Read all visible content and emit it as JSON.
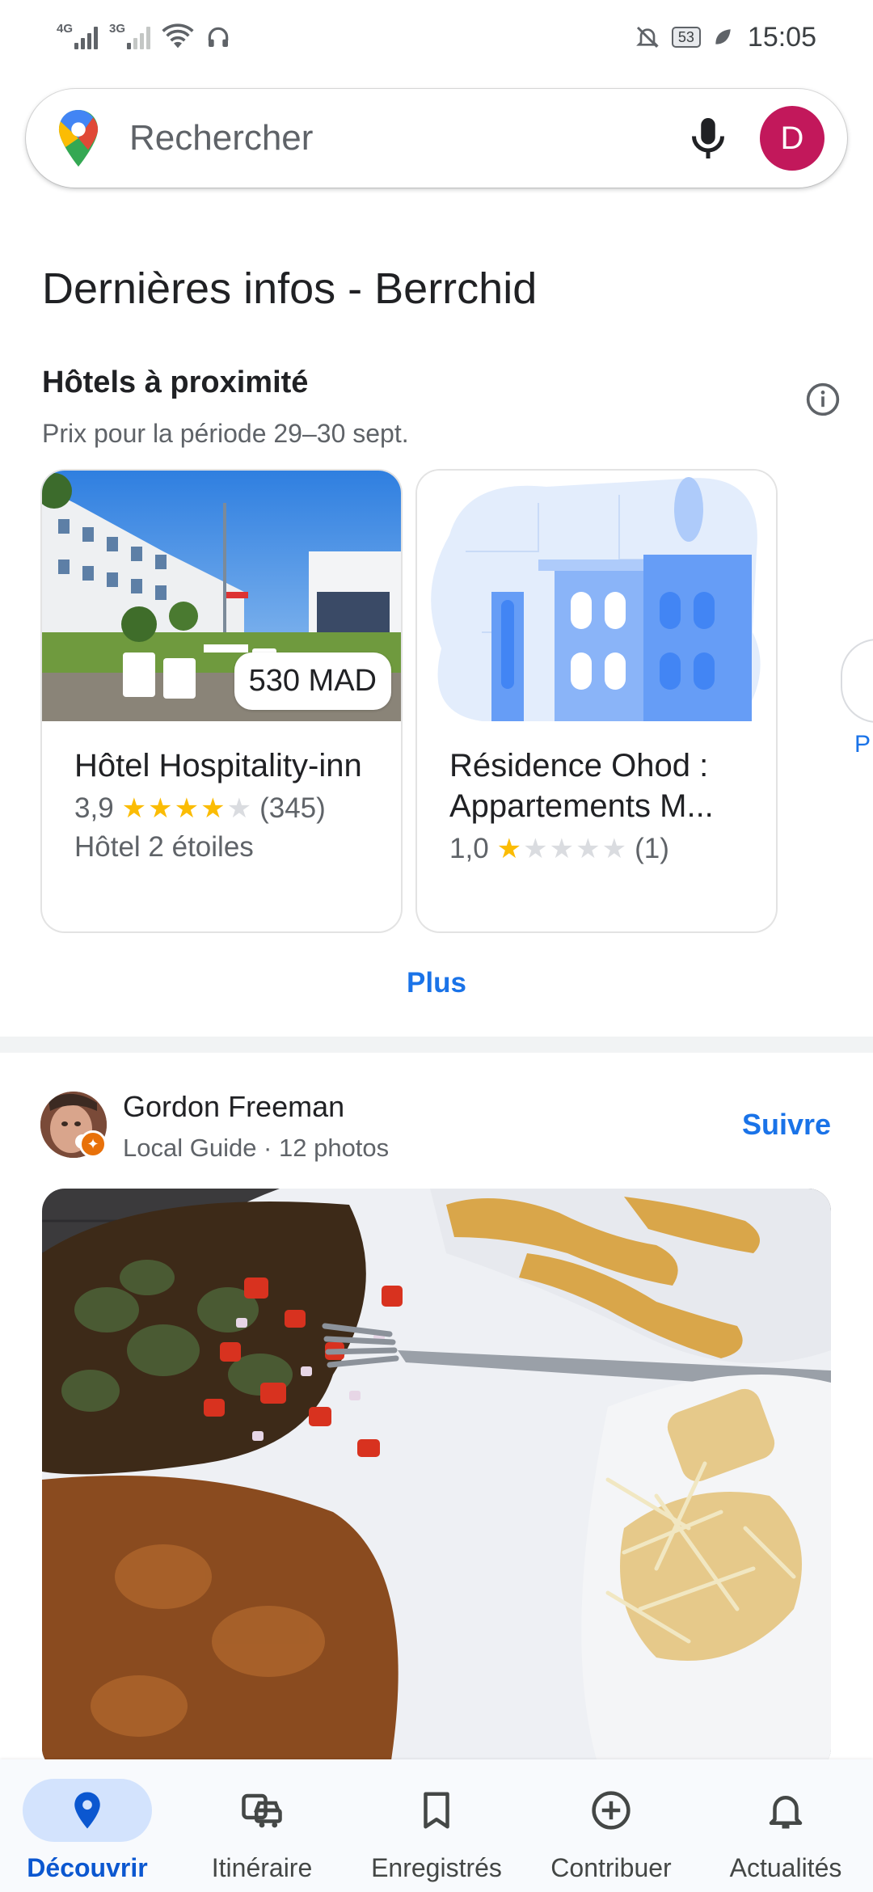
{
  "status_bar": {
    "sim1": "4G",
    "sim2": "3G",
    "battery": "53",
    "time": "15:05"
  },
  "search": {
    "placeholder": "Rechercher",
    "avatar_letter": "D"
  },
  "headline": "Dernières infos - Berrchid",
  "hotels": {
    "title": "Hôtels à proximité",
    "subtitle": "Prix pour la période 29–30 sept.",
    "items": [
      {
        "name": "Hôtel Hospitality-inn",
        "price": "530 MAD",
        "rating_text": "3,9",
        "rating_value": 3.9,
        "reviews": "(345)",
        "type": "Hôtel 2 étoiles"
      },
      {
        "name": "Résidence Ohod : Appartements M...",
        "rating_text": "1,0",
        "rating_value": 1.0,
        "reviews": "(1)"
      }
    ],
    "peek_label": "P",
    "more_label": "Plus"
  },
  "post": {
    "author": "Gordon Freeman",
    "meta": "Local Guide · 12 photos",
    "follow_label": "Suivre"
  },
  "bottom_nav": {
    "items": [
      {
        "label": "Découvrir",
        "icon": "pin-icon",
        "active": true
      },
      {
        "label": "Itinéraire",
        "icon": "commute-icon",
        "active": false
      },
      {
        "label": "Enregistrés",
        "icon": "bookmark-icon",
        "active": false
      },
      {
        "label": "Contribuer",
        "icon": "add-circle-icon",
        "active": false
      },
      {
        "label": "Actualités",
        "icon": "bell-icon",
        "active": false
      }
    ]
  },
  "colors": {
    "accent": "#1a73e8",
    "avatar": "#c2185b",
    "star": "#fbbc04",
    "nav_active_bg": "#d3e3fd"
  }
}
